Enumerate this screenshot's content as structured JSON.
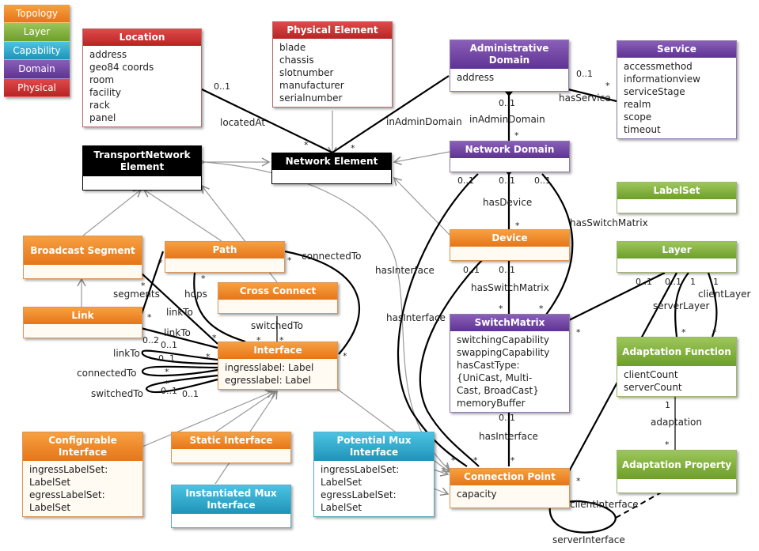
{
  "legend": {
    "items": [
      {
        "label": "Topology",
        "color": "#ec8322"
      },
      {
        "label": "Layer",
        "color": "#7aab36"
      },
      {
        "label": "Capability",
        "color": "#27a5cb"
      },
      {
        "label": "Domain",
        "color": "#6a3fa0"
      },
      {
        "label": "Physical",
        "color": "#c83030"
      }
    ]
  },
  "classes": {
    "location": {
      "title": "Location",
      "category": "Physical",
      "attributes": "address\ngeo84 coords\nroom\nfacility\nrack\npanel"
    },
    "physical_element": {
      "title": "Physical Element",
      "category": "Physical",
      "attributes": "blade\nchassis\nslotnumber\nmanufacturer\nserialnumber"
    },
    "administrative_domain": {
      "title": "Administrative Domain",
      "category": "Domain",
      "attributes": "address"
    },
    "service": {
      "title": "Service",
      "category": "Domain",
      "attributes": "accessmethod\ninformationview\nserviceStage\nrealm\nscope\ntimeout"
    },
    "transport_network_element": {
      "title": "TransportNetwork Element",
      "category": "Base",
      "attributes": ""
    },
    "network_element": {
      "title": "Network Element",
      "category": "Base",
      "attributes": ""
    },
    "network_domain": {
      "title": "Network Domain",
      "category": "Domain",
      "attributes": ""
    },
    "labelset": {
      "title": "LabelSet",
      "category": "Layer",
      "attributes": ""
    },
    "broadcast_segment": {
      "title": "Broadcast Segment",
      "category": "Topology",
      "attributes": ""
    },
    "path": {
      "title": "Path",
      "category": "Topology",
      "attributes": ""
    },
    "device": {
      "title": "Device",
      "category": "Topology",
      "attributes": ""
    },
    "layer": {
      "title": "Layer",
      "category": "Layer",
      "attributes": ""
    },
    "cross_connect": {
      "title": "Cross Connect",
      "category": "Topology",
      "attributes": ""
    },
    "link": {
      "title": "Link",
      "category": "Topology",
      "attributes": ""
    },
    "switch_matrix": {
      "title": "SwitchMatrix",
      "category": "Domain",
      "attributes": "switchingCapability\nswappingCapability\nhasCastType:\n{UniCast, Multi-\nCast, BroadCast}\nmemoryBuffer"
    },
    "interface": {
      "title": "Interface",
      "category": "Topology",
      "attributes": "ingresslabel: Label\negresslabel: Label"
    },
    "adaptation_function": {
      "title": "Adaptation Function",
      "category": "Layer",
      "attributes": "clientCount\nserverCount"
    },
    "configurable_interface": {
      "title": "Configurable Interface",
      "category": "Topology",
      "attributes": "ingressLabelSet:\nLabelSet\negressLabelSet:\nLabelSet"
    },
    "static_interface": {
      "title": "Static Interface",
      "category": "Topology",
      "attributes": ""
    },
    "potential_mux_interface": {
      "title": "Potential Mux Interface",
      "category": "Capability",
      "attributes": "ingressLabelSet:\nLabelSet\negressLabelSet:\nLabelSet"
    },
    "connection_point": {
      "title": "Connection Point",
      "category": "Topology",
      "attributes": "capacity"
    },
    "adaptation_property": {
      "title": "Adaptation Property",
      "category": "Layer",
      "attributes": ""
    },
    "instantiated_mux_interface": {
      "title": "Instantiated Mux Interface",
      "category": "Capability",
      "attributes": ""
    }
  },
  "labels": {
    "locatedAt": "locatedAt",
    "inAdminDomain1": "inAdminDomain",
    "inAdminDomain2": "inAdminDomain",
    "hasService": "hasService",
    "hasDevice": "hasDevice",
    "hasSwitchMatrix1": "hasSwitchMatrix",
    "hasSwitchMatrix2": "hasSwitchMatrix",
    "hasInterface1": "hasInterface",
    "hasInterface2": "hasInterface",
    "hasInterface3": "hasInterface",
    "connectedTo1": "connectedTo",
    "connectedTo2": "connectedTo",
    "segments": "segments",
    "hops": "hops",
    "linkTo1": "linkTo",
    "linkTo2": "linkTo",
    "linkTo3": "linkTo",
    "switchedTo1": "switchedTo",
    "switchedTo2": "switchedTo",
    "serverLayer": "serverLayer",
    "clientLayer": "clientLayer",
    "adaptation": "adaptation",
    "clientInterface": "clientInterface",
    "serverInterface": "serverInterface"
  },
  "multiplicity": {
    "m01": "0..1",
    "many": "*",
    "one": "1",
    "m02": "0..2"
  }
}
